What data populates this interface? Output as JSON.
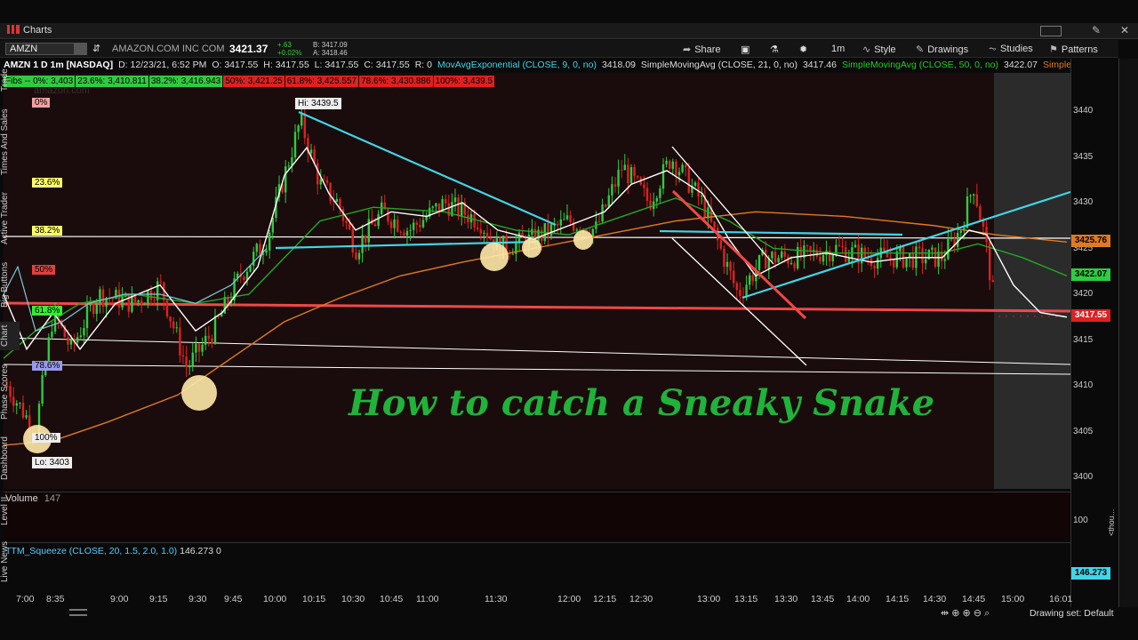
{
  "app": {
    "title": "Charts"
  },
  "toolbar": {
    "symbol": "AMZN",
    "company": "AMAZON.COM INC COM",
    "last": "3421.37",
    "change": "+.63",
    "change_pct": "+0.02%",
    "bid": "B: 3417.09",
    "ask": "A: 3418.46",
    "share": "Share",
    "timeframe": "1m",
    "style": "Style",
    "drawings": "Drawings",
    "studies": "Studies",
    "patterns": "Patterns"
  },
  "header": {
    "symbol_desc": "AMZN 1 D 1m [NASDAQ]",
    "date": "D: 12/23/21, 6:52 PM",
    "open": "O: 3417.55",
    "high": "H: 3417.55",
    "low": "L: 3417.55",
    "close": "C: 3417.55",
    "range": "R: 0",
    "ema": "MovAvgExponential (CLOSE, 9, 0, no)",
    "ema_val": "3418.09",
    "sma21": "SimpleMovingAvg (CLOSE, 21, 0, no)",
    "sma21_val": "3417.46",
    "sma50": "SimpleMovingAvg (CLOSE, 50, 0, no)",
    "sma50_val": "3422.07",
    "sma_more": "Simple..."
  },
  "fibs": [
    {
      "text": "Fibs -- 0%: 3,403",
      "color": "#2ecc40"
    },
    {
      "text": "23.6%: 3,410.811",
      "color": "#2ecc40"
    },
    {
      "text": "38.2%: 3,416.943",
      "color": "#2ecc40"
    },
    {
      "text": "50%: 3,421.25",
      "color": "#e02020"
    },
    {
      "text": "61.8%: 3,425.557",
      "color": "#e02020"
    },
    {
      "text": "78.6%: 3,430.886",
      "color": "#e02020"
    },
    {
      "text": "100%: 3,439.5",
      "color": "#e02020"
    }
  ],
  "watermark": "amazon.com",
  "fib_labels": [
    "0%",
    "23.6%",
    "38.2%",
    "50%",
    "61.8%",
    "78.6%",
    "100%"
  ],
  "hi_label": "Hi: 3439.5",
  "lo_label": "Lo: 3403",
  "overlay_title": "How to catch a Sneaky Snake",
  "price_axis": {
    "ticks": [
      "3440",
      "3435",
      "3430",
      "3425",
      "3420",
      "3415",
      "3410",
      "3405",
      "3400"
    ],
    "last_orange": "3425.76",
    "last_green": "3422.07",
    "last_red": "3417.55"
  },
  "volume": {
    "label": "Volume",
    "value": "147",
    "axis": "100"
  },
  "squeeze": {
    "label": "TTM_Squeeze (CLOSE, 20, 1.5, 2.0, 1.0)",
    "value": "146.273",
    "zero": "0",
    "badge": "146.273"
  },
  "time_axis": [
    "7:00",
    "8:35",
    "9:00",
    "9:15",
    "9:30",
    "9:45",
    "10:00",
    "10:15",
    "10:30",
    "10:45",
    "11:00",
    "11:30",
    "12:00",
    "12:15",
    "12:30",
    "13:00",
    "13:15",
    "13:30",
    "13:45",
    "14:00",
    "14:15",
    "14:30",
    "14:45",
    "15:00",
    "16:01"
  ],
  "sidebar": [
    "Trade",
    "Times And Sales",
    "Active Trader",
    "Big Buttons",
    "Chart",
    "Phase Scores",
    "Dashboard",
    "Level II",
    "Live News"
  ],
  "thou": "<thou...",
  "drawing_set": "Drawing set: Default",
  "colors": {
    "up": "#2ecc40",
    "down": "#e02020",
    "ema": "#ffffff",
    "sma21": "#22aa22",
    "sma50": "#e07a20",
    "cyan": "#3fd6e8"
  }
}
